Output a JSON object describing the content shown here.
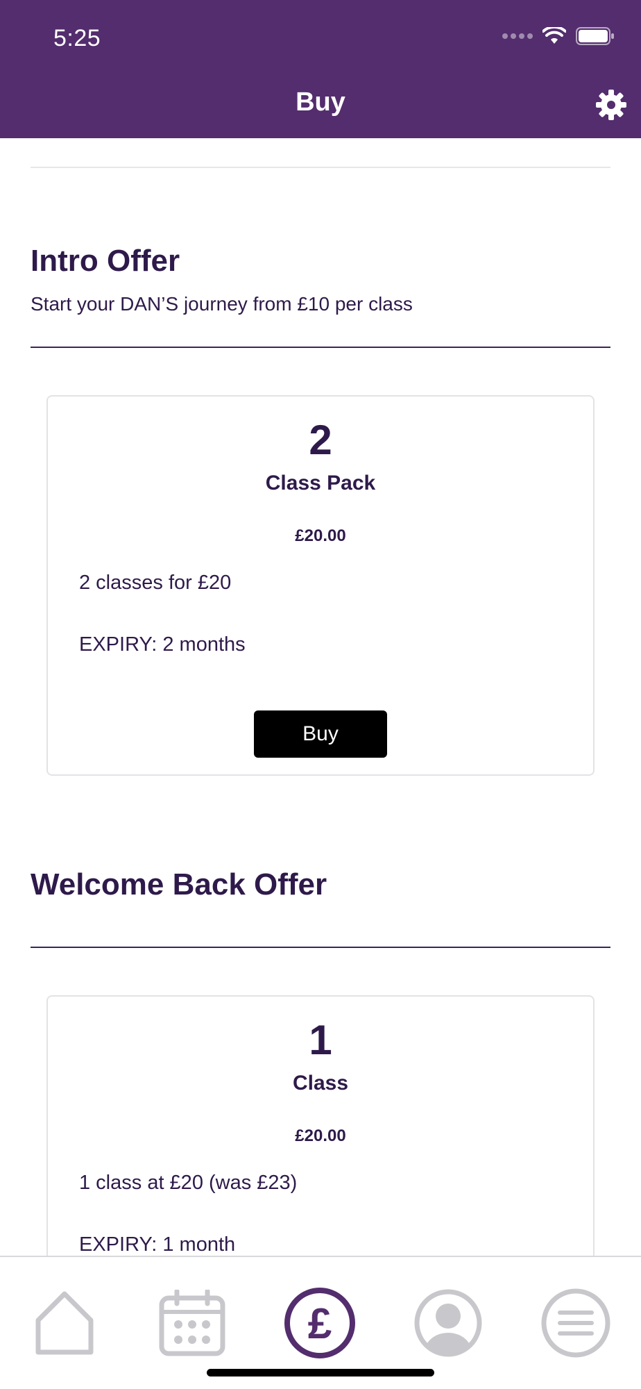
{
  "status_bar": {
    "time": "5:25"
  },
  "header": {
    "title": "Buy"
  },
  "sections": [
    {
      "title": "Intro Offer",
      "subtitle": "Start your DAN’S journey from £10 per class",
      "card": {
        "count": "2",
        "name": "Class Pack",
        "price": "£20.00",
        "description": "2 classes for £20",
        "expiry": "EXPIRY: 2 months",
        "buy_label": "Buy"
      }
    },
    {
      "title": "Welcome Back Offer",
      "card": {
        "count": "1",
        "name": "Class",
        "price": "£20.00",
        "description": "1 class at £20 (was £23)",
        "expiry": "EXPIRY: 1 month"
      }
    }
  ],
  "tabbar": {
    "active_tab": "buy",
    "tabs": [
      {
        "id": "home",
        "icon": "home-icon"
      },
      {
        "id": "schedule",
        "icon": "calendar-icon"
      },
      {
        "id": "buy",
        "icon": "pound-icon"
      },
      {
        "id": "profile",
        "icon": "profile-icon"
      },
      {
        "id": "menu",
        "icon": "menu-icon"
      }
    ]
  },
  "colors": {
    "header_bg": "#532d6d",
    "text_primary": "#2e1a4a",
    "active_tab": "#532d6d",
    "inactive_tab": "#c8c8cc",
    "buy_button": "#000000"
  }
}
